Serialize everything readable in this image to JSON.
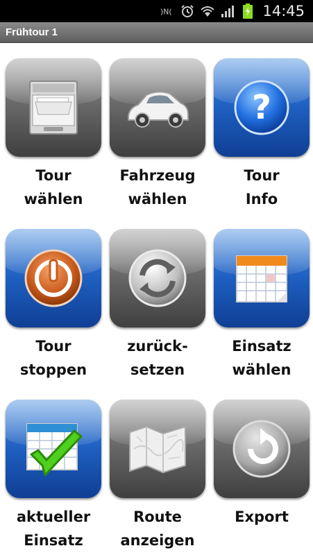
{
  "status_bar": {
    "time": "14:45",
    "icons": [
      "nfc-icon",
      "alarm-icon",
      "wifi-icon",
      "signal-icon",
      "battery-charging-icon"
    ]
  },
  "window": {
    "title": "Frühtour 1"
  },
  "tiles": [
    {
      "line1": "Tour",
      "line2": "wählen",
      "icon": "file-drawer-icon",
      "style": "gray"
    },
    {
      "line1": "Fahrzeug",
      "line2": "wählen",
      "icon": "car-icon",
      "style": "gray"
    },
    {
      "line1": "Tour",
      "line2": "Info",
      "icon": "question-icon",
      "style": "blue"
    },
    {
      "line1": "Tour",
      "line2": "stoppen",
      "icon": "power-icon",
      "style": "blue"
    },
    {
      "line1": "zurück-",
      "line2": "setzen",
      "icon": "refresh-icon",
      "style": "gray"
    },
    {
      "line1": "Einsatz",
      "line2": "wählen",
      "icon": "calendar-icon",
      "style": "blue"
    },
    {
      "line1": "aktueller",
      "line2": "Einsatz",
      "icon": "checkmark-calendar-icon",
      "style": "blue"
    },
    {
      "line1": "Route",
      "line2": "anzeigen",
      "icon": "map-icon",
      "style": "gray"
    },
    {
      "line1": "Export",
      "line2": "",
      "icon": "export-icon",
      "style": "gray"
    }
  ],
  "colors": {
    "blue_tile": "#1e5fc0",
    "gray_tile": "#6a6a6a",
    "battery": "#8bdc22"
  }
}
